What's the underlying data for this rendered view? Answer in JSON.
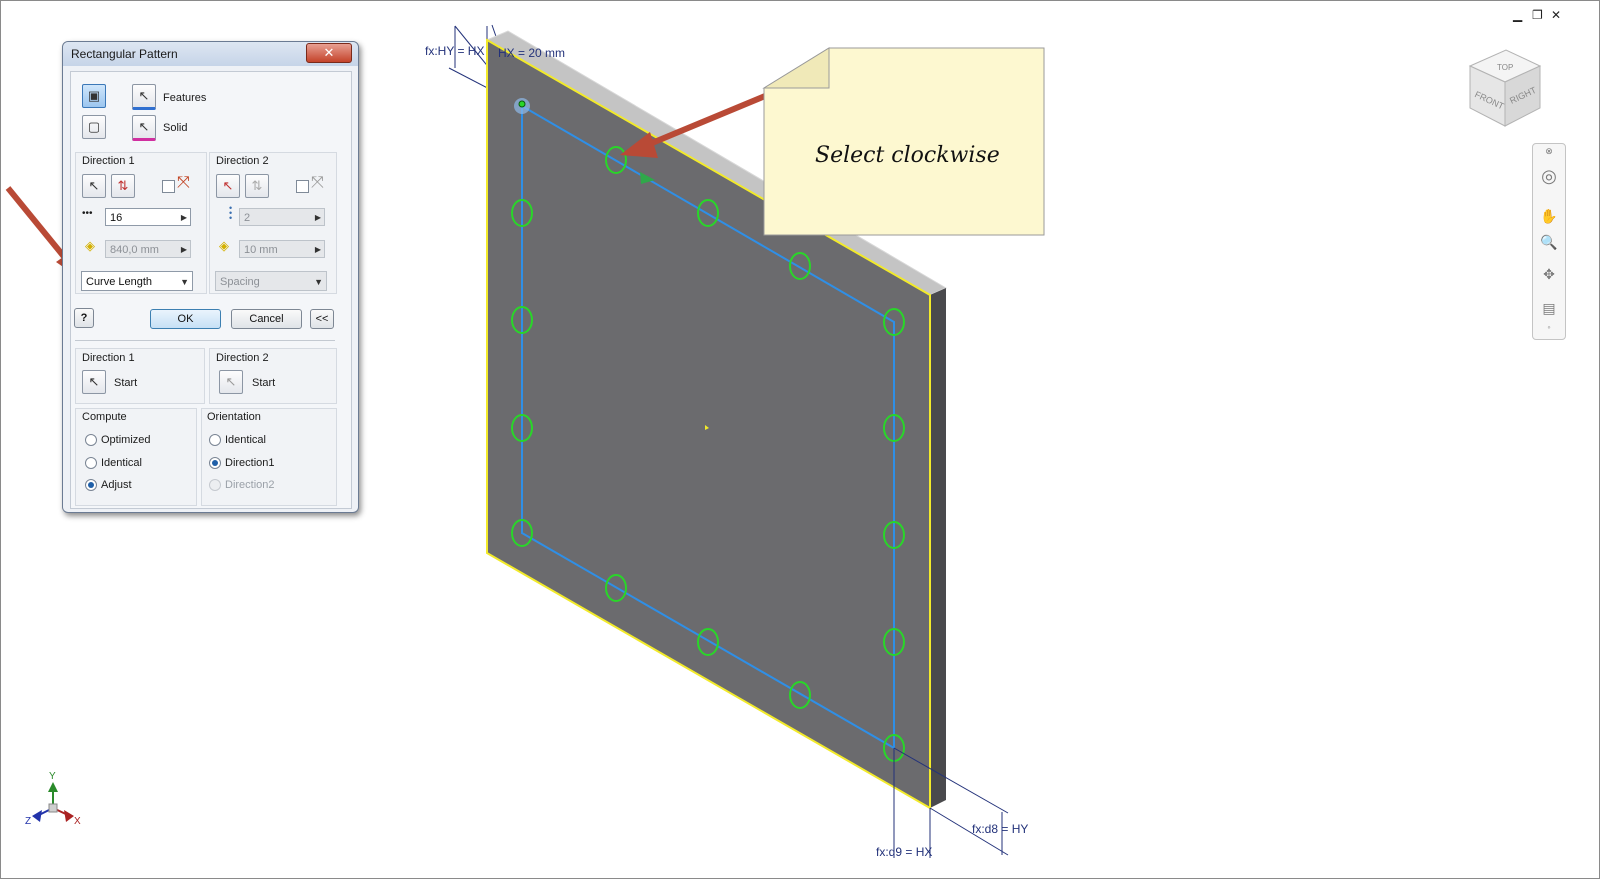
{
  "window_controls": {
    "minimize": "▁",
    "restore": "❐",
    "close": "✕"
  },
  "dialog": {
    "title": "Rectangular Pattern",
    "close_label": "✕",
    "features_label": "Features",
    "solid_label": "Solid",
    "direction1": {
      "title": "Direction 1",
      "count_value": "16",
      "length_value": "840,0 mm",
      "spacing_mode": "Curve Length"
    },
    "direction2": {
      "title": "Direction 2",
      "count_value": "2",
      "length_value": "10 mm",
      "spacing_mode": "Spacing"
    },
    "help_label": "?",
    "ok_label": "OK",
    "cancel_label": "Cancel",
    "collapse_label": "<<",
    "start_section": {
      "direction1_title": "Direction 1",
      "direction1_start": "Start",
      "direction2_title": "Direction 2",
      "direction2_start": "Start"
    },
    "compute": {
      "title": "Compute",
      "options": [
        "Optimized",
        "Identical",
        "Adjust"
      ],
      "selected": "Adjust"
    },
    "orientation": {
      "title": "Orientation",
      "options": [
        "Identical",
        "Direction1",
        "Direction2"
      ],
      "selected": "Direction1"
    }
  },
  "note": {
    "text": "Select clockwise"
  },
  "dimensions": {
    "top_left": "fx:HY = HX",
    "top": "HX = 20 mm",
    "bottom_right": "fx:d8 = HY",
    "bottom": "fx:d9 = HX"
  },
  "viewcube": {
    "top": "TOP",
    "front": "FRONT",
    "right": "RIGHT"
  },
  "axes": {
    "x": "X",
    "y": "Y",
    "z": "Z"
  },
  "colors": {
    "plate_face": "#6b6b6e",
    "plate_edge": "#f2ea2a",
    "sketch_line": "#2f8fe6",
    "hole_outline": "#29d629",
    "arrow": "#b94a36",
    "note_bg": "#fdf8d0",
    "dimension": "#23327a"
  }
}
